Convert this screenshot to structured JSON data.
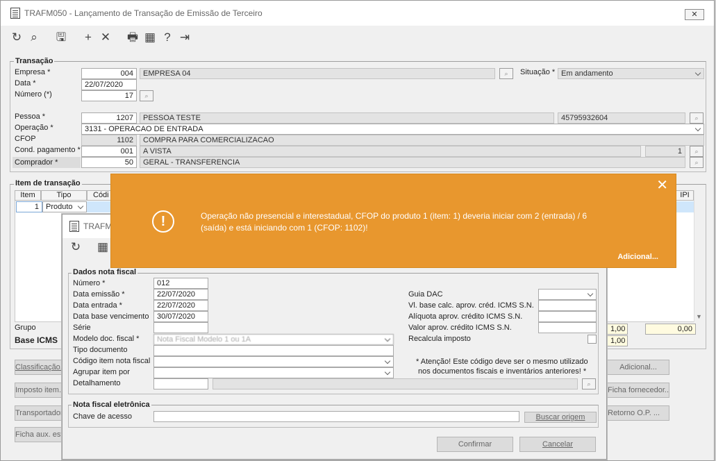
{
  "main": {
    "title": "TRAFM050 - Lançamento de Transação de Emissão de Terceiro",
    "close_label": "✕",
    "toolbar": {
      "refresh_icon": "↻",
      "search_icon": "⌕",
      "save_icon": "🖫",
      "add_icon": "+",
      "delete_icon": "✕",
      "print_icon": "🖶",
      "calendar_icon": "▦",
      "help_icon": "?",
      "exit_icon": "⇥"
    },
    "transacao": {
      "legend": "Transação",
      "empresa_label": "Empresa *",
      "empresa_code": "004",
      "empresa_name": "EMPRESA 04",
      "situacao_label": "Situação *",
      "situacao_value": "Em andamento",
      "data_label": "Data *",
      "data_value": "22/07/2020",
      "numero_label": "Número (*)",
      "numero_value": "17",
      "pessoa_label": "Pessoa *",
      "pessoa_code": "1207",
      "pessoa_name": "PESSOA TESTE",
      "pessoa_doc": "45795932604",
      "operacao_label": "Operação *",
      "operacao_value": "3131 - OPERACAO DE ENTRADA",
      "cfop_label": "CFOP",
      "cfop_code": "1102",
      "cfop_desc": "COMPRA PARA COMERCIALIZACAO",
      "cond_label": "Cond. pagamento *",
      "cond_code": "001",
      "cond_desc": "A VISTA",
      "cond_qty": "1",
      "comprador_label": "Comprador *",
      "comprador_code": "50",
      "comprador_desc": "GERAL - TRANSFERENCIA"
    },
    "itens": {
      "legend": "Item de transação",
      "col_item": "Item",
      "col_tipo": "Tipo",
      "col_codigo": "Códi",
      "col_ipi": "IPI",
      "row_item": "1",
      "row_tipo": "Produto",
      "grupo_label": "Grupo",
      "base_icms_label": "Base ICMS",
      "val1": "1,00",
      "val2": "0,00",
      "val3": "1,00"
    },
    "buttons": {
      "classificacao": "Classificação...",
      "imposto": "Imposto item...",
      "transportadora": "Transportadora...",
      "ficha_aux": "Ficha aux. estoque...",
      "adicional": "Adicional...",
      "ficha_fornecedor": "Ficha fornecedor...",
      "retorno_op": "Retorno O.P. ..."
    }
  },
  "dialog": {
    "title": "TRAFM",
    "refresh_icon": "↻",
    "calendar_icon": "▦",
    "dados": {
      "legend": "Dados nota fiscal",
      "numero_label": "Número *",
      "numero_value": "012",
      "emissao_label": "Data emissão *",
      "emissao_value": "22/07/2020",
      "entrada_label": "Data entrada *",
      "entrada_value": "22/07/2020",
      "vencimento_label": "Data base vencimento",
      "vencimento_value": "30/07/2020",
      "serie_label": "Série",
      "serie_value": "",
      "modelo_label": "Modelo doc. fiscal *",
      "modelo_value": "Nota Fiscal Modelo 1 ou 1A",
      "tipo_doc_label": "Tipo documento",
      "codigo_item_label": "Código item nota fiscal",
      "agrupar_label": "Agrupar item por",
      "detalhamento_label": "Detalhamento",
      "guia_dac_label": "Guia DAC",
      "vl_base_label": "Vl. base calc. aprov. créd. ICMS S.N.",
      "aliquota_label": "Alíquota aprov. crédito ICMS S.N.",
      "valor_aprov_label": "Valor aprov. crédito ICMS S.N.",
      "recalcula_label": "Recalcula imposto",
      "aviso_line1": "* Atenção! Este código deve ser o mesmo utilizado",
      "aviso_line2": "nos documentos fiscais e inventários anteriores! *"
    },
    "nfe": {
      "legend": "Nota fiscal eletrônica",
      "chave_label": "Chave de acesso",
      "chave_value": "",
      "buscar_label": "Buscar origem"
    },
    "confirmar_label": "Confirmar",
    "cancelar_label": "Cancelar"
  },
  "toast": {
    "icon": "!",
    "message": "Operação não presencial e interestadual, CFOP do produto 1 (item: 1) deveria iniciar com 2 (entrada) / 6 (saída) e está iniciando com 1 (CFOP: 1102)!",
    "close": "✕",
    "more_label": "Adicional...",
    "color": "#e8972e"
  }
}
